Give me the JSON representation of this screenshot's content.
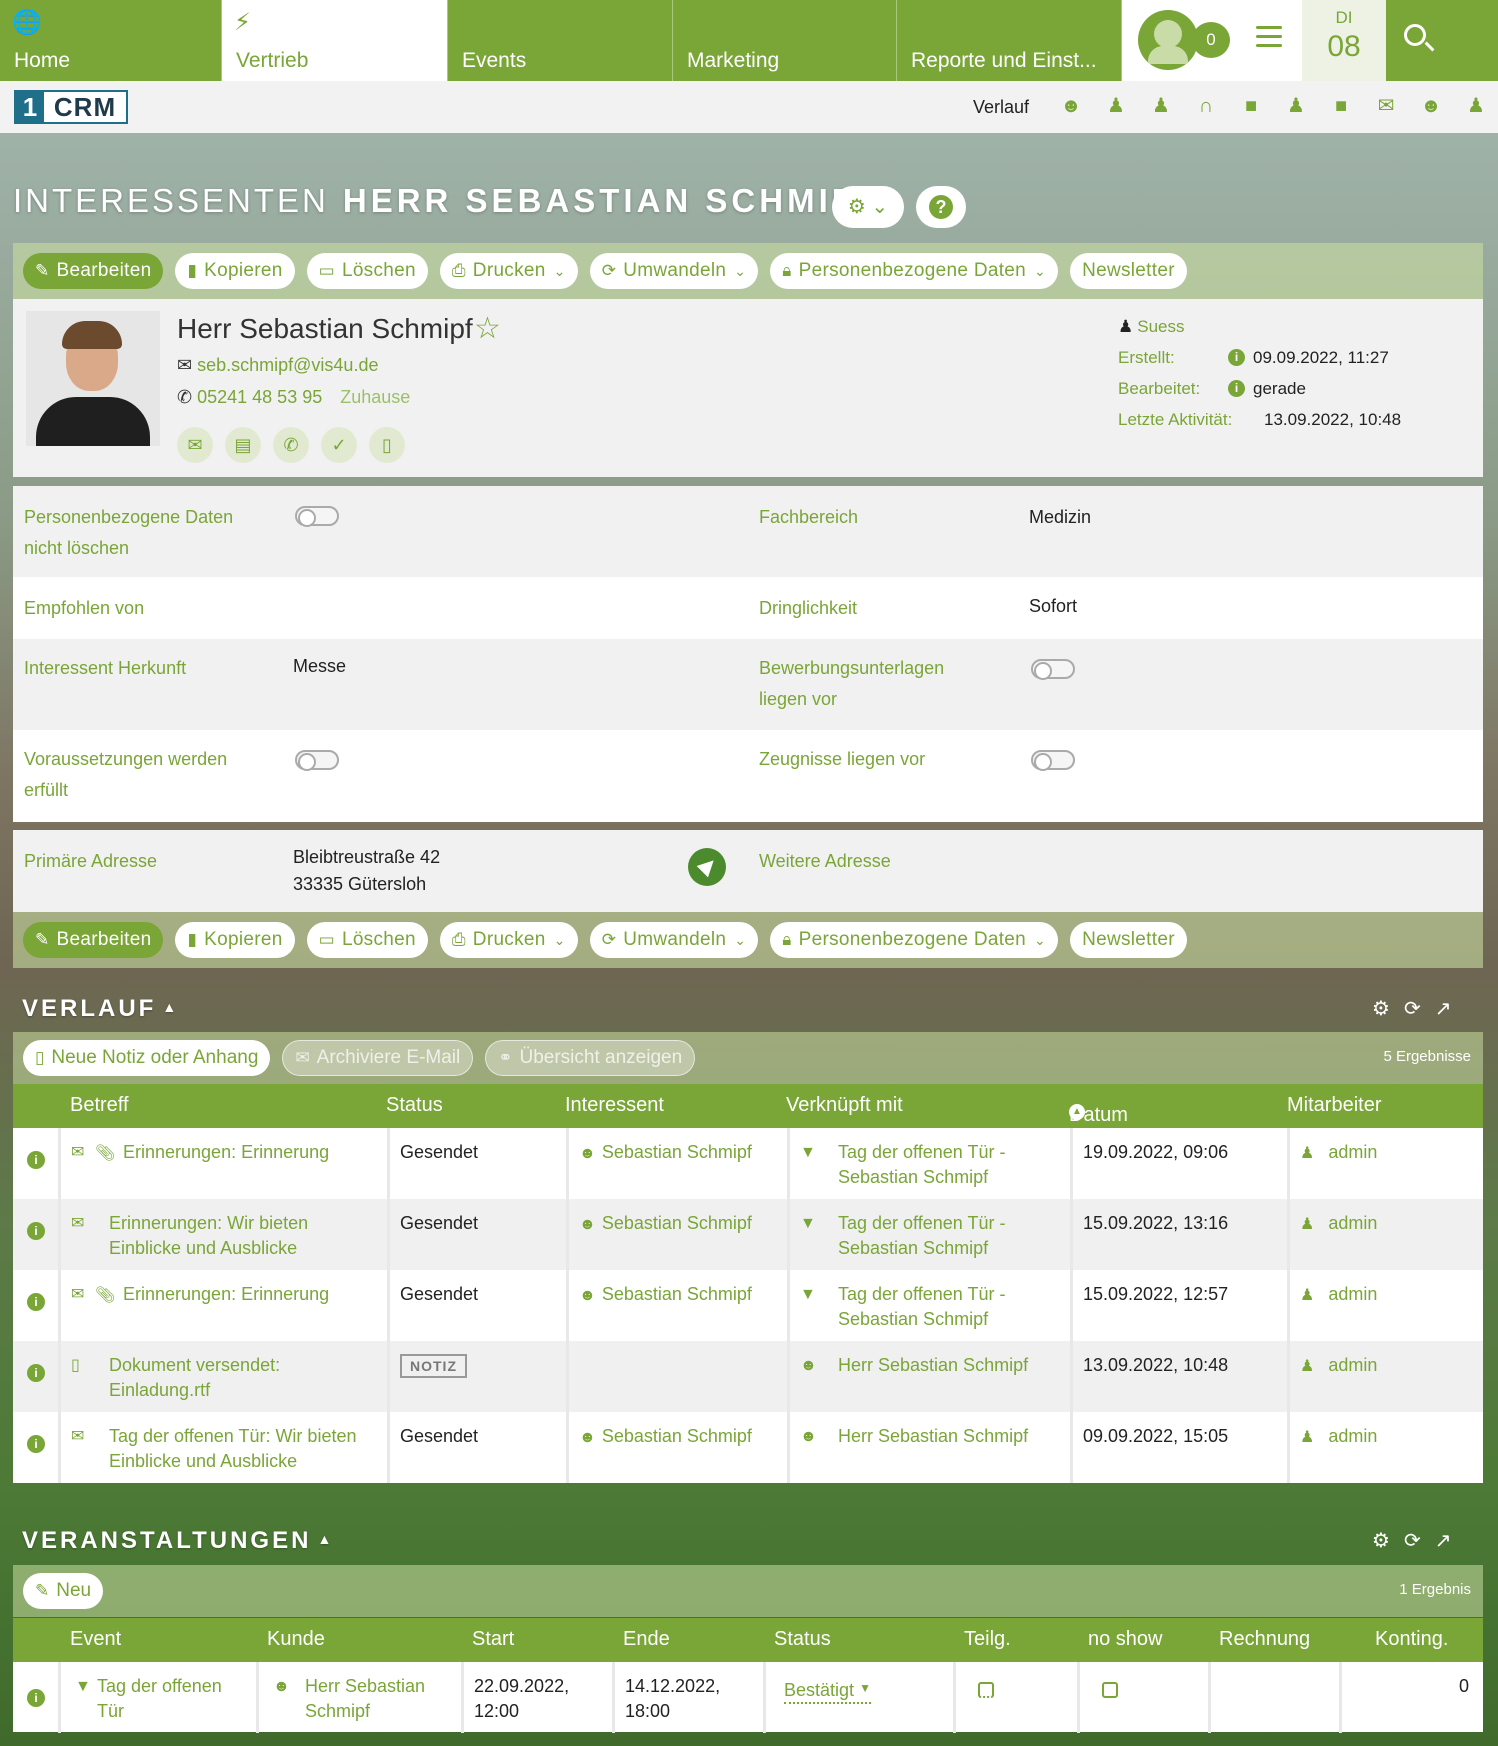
{
  "nav": {
    "tabs": [
      {
        "label": "Home",
        "icon": "globe-icon"
      },
      {
        "label": "Vertrieb",
        "icon": "bolt-icon"
      },
      {
        "label": "Events"
      },
      {
        "label": "Marketing"
      },
      {
        "label": "Reporte und Einst..."
      }
    ],
    "notification_count": "0",
    "date_weekday": "DI",
    "date_day": "08"
  },
  "secbar": {
    "logo_one": "1",
    "logo_crm": "CRM",
    "history_label": "Verlauf"
  },
  "title": {
    "module": "INTERESSENTEN",
    "record": "HERR SEBASTIAN SCHMIPF"
  },
  "actions": {
    "edit": "Bearbeiten",
    "copy": "Kopieren",
    "delete": "Löschen",
    "print": "Drucken",
    "convert": "Umwandeln",
    "personal_data": "Personenbezogene Daten",
    "newsletter": "Newsletter"
  },
  "record": {
    "name": "Herr Sebastian Schmipf",
    "email": "seb.schmipf@vis4u.de",
    "phone": "05241 48 53 95",
    "phone_type": "Zuhause",
    "assigned_user": "Suess",
    "created_label": "Erstellt:",
    "created_value": "09.09.2022, 11:27",
    "modified_label": "Bearbeitet:",
    "modified_value": "gerade",
    "last_activity_label": "Letzte Aktivität:",
    "last_activity_value": "13.09.2022, 10:48"
  },
  "fields": {
    "no_delete_label_1": "Personenbezogene Daten",
    "no_delete_label_2": "nicht löschen",
    "department_label": "Fachbereich",
    "department_value": "Medizin",
    "referred_label": "Empfohlen von",
    "urgency_label": "Dringlichkeit",
    "urgency_value": "Sofort",
    "source_label": "Interessent Herkunft",
    "source_value": "Messe",
    "documents_label_1": "Bewerbungsunterlagen",
    "documents_label_2": "liegen vor",
    "requirements_label_1": "Voraussetzungen werden",
    "requirements_label_2": "erfüllt",
    "certificates_label": "Zeugnisse liegen vor",
    "primary_address_label": "Primäre Adresse",
    "primary_address_line1": "Bleibtreustraße 42",
    "primary_address_line2": "33335 Gütersloh",
    "other_address_label": "Weitere Adresse"
  },
  "history": {
    "title": "VERLAUF",
    "btn_note": "Neue Notiz oder Anhang",
    "btn_archive": "Archiviere E-Mail",
    "btn_overview": "Übersicht anzeigen",
    "count": "5 Ergebnisse",
    "columns": [
      "Betreff",
      "Status",
      "Interessent",
      "Verknüpft mit",
      "Datum",
      "Mitarbeiter"
    ],
    "rows": [
      {
        "subject1": "Erinnerungen: Erinnerung",
        "subject2": "",
        "status": "Gesendet",
        "lead": "Sebastian Schmipf",
        "related1": "Tag der offenen Tür -",
        "related2": "Sebastian Schmipf",
        "date": "19.09.2022, 09:06",
        "user": "admin"
      },
      {
        "subject1": "Erinnerungen: Wir bieten",
        "subject2": "Einblicke und Ausblicke",
        "status": "Gesendet",
        "lead": "Sebastian Schmipf",
        "related1": "Tag der offenen Tür -",
        "related2": "Sebastian Schmipf",
        "date": "15.09.2022, 13:16",
        "user": "admin"
      },
      {
        "subject1": "Erinnerungen: Erinnerung",
        "subject2": "",
        "status": "Gesendet",
        "lead": "Sebastian Schmipf",
        "related1": "Tag der offenen Tür -",
        "related2": "Sebastian Schmipf",
        "date": "15.09.2022, 12:57",
        "user": "admin"
      },
      {
        "subject1": "Dokument versendet:",
        "subject2": "Einladung.rtf",
        "status": "NOTIZ",
        "lead": "",
        "related1": "Herr Sebastian Schmipf",
        "related2": "",
        "date": "13.09.2022, 10:48",
        "user": "admin"
      },
      {
        "subject1": "Tag der offenen Tür: Wir bieten",
        "subject2": "Einblicke und Ausblicke",
        "status": "Gesendet",
        "lead": "Sebastian Schmipf",
        "related1": "Herr Sebastian Schmipf",
        "related2": "",
        "date": "09.09.2022, 15:05",
        "user": "admin"
      }
    ]
  },
  "events": {
    "title": "VERANSTALTUNGEN",
    "btn_new": "Neu",
    "count": "1 Ergebnis",
    "columns": [
      "Event",
      "Kunde",
      "Start",
      "Ende",
      "Status",
      "Teilg.",
      "no show",
      "Rechnung",
      "Konting."
    ],
    "row": {
      "event1": "Tag der offenen",
      "event2": "Tür",
      "customer1": "Herr Sebastian",
      "customer2": "Schmipf",
      "start1": "22.09.2022,",
      "start2": "12:00",
      "end1": "14.12.2022,",
      "end2": "18:00",
      "status": "Bestätigt",
      "quota": "0"
    }
  }
}
